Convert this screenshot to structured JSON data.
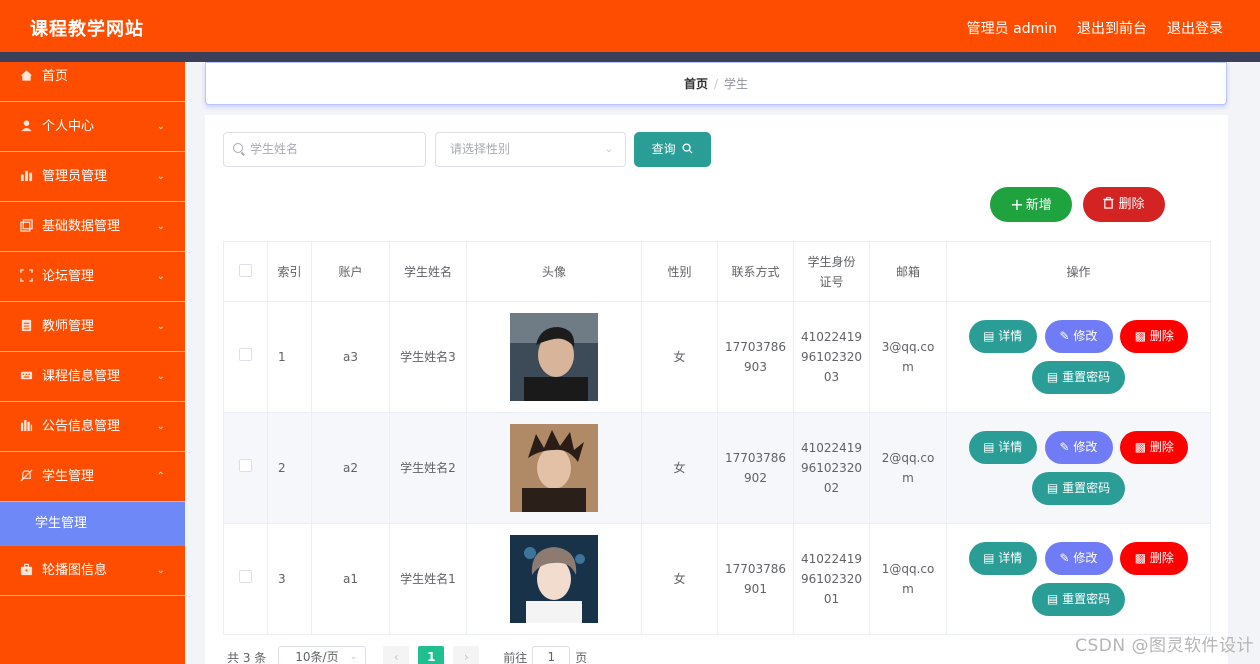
{
  "header": {
    "site_title": "课程教学网站",
    "admin_label": "管理员 admin",
    "to_front_label": "退出到前台",
    "logout_label": "退出登录"
  },
  "sidebar": {
    "items": [
      {
        "label": "首页",
        "icon": "home-icon"
      },
      {
        "label": "个人中心",
        "icon": "user-icon"
      },
      {
        "label": "管理员管理",
        "icon": "bar-chart-icon"
      },
      {
        "label": "基础数据管理",
        "icon": "copy-icon"
      },
      {
        "label": "论坛管理",
        "icon": "fullscreen-icon"
      },
      {
        "label": "教师管理",
        "icon": "document-icon"
      },
      {
        "label": "课程信息管理",
        "icon": "keyboard-icon"
      },
      {
        "label": "公告信息管理",
        "icon": "data-icon"
      },
      {
        "label": "学生管理",
        "icon": "no-bell-icon"
      },
      {
        "label": "轮播图信息",
        "icon": "suitcase-icon"
      }
    ],
    "active_sub": "学生管理"
  },
  "breadcrumb": {
    "home": "首页",
    "sep": "/",
    "current": "学生"
  },
  "search": {
    "name_placeholder": "学生姓名",
    "gender_placeholder": "请选择性别",
    "query_label": "查询"
  },
  "actions": {
    "add_label": "新增",
    "delete_label": "删除"
  },
  "table": {
    "headers": [
      "索引",
      "账户",
      "学生姓名",
      "头像",
      "性别",
      "联系方式",
      "学生身份证号",
      "邮箱",
      "操作"
    ],
    "rows": [
      {
        "index": "1",
        "account": "a3",
        "name": "学生姓名3",
        "gender": "女",
        "phone": "17703786903",
        "id_card": "410224199610232003",
        "email": "3@qq.com"
      },
      {
        "index": "2",
        "account": "a2",
        "name": "学生姓名2",
        "gender": "女",
        "phone": "17703786902",
        "id_card": "410224199610232002",
        "email": "2@qq.com"
      },
      {
        "index": "3",
        "account": "a1",
        "name": "学生姓名1",
        "gender": "女",
        "phone": "17703786901",
        "id_card": "410224199610232001",
        "email": "1@qq.com"
      }
    ],
    "op_labels": {
      "detail": "详情",
      "edit": "修改",
      "delete": "删除",
      "reset": "重置密码"
    }
  },
  "pagination": {
    "total": "共 3 条",
    "page_size": "10条/页",
    "current_page": "1",
    "goto_label": "前往",
    "goto_value": "1",
    "page_unit": "页"
  },
  "watermark": "CSDN @图灵软件设计",
  "colors": {
    "brand": "#ff4d00",
    "accent": "#6f88f8",
    "teal": "#2a9d96",
    "green": "#1fa33f",
    "red": "#d42323"
  }
}
